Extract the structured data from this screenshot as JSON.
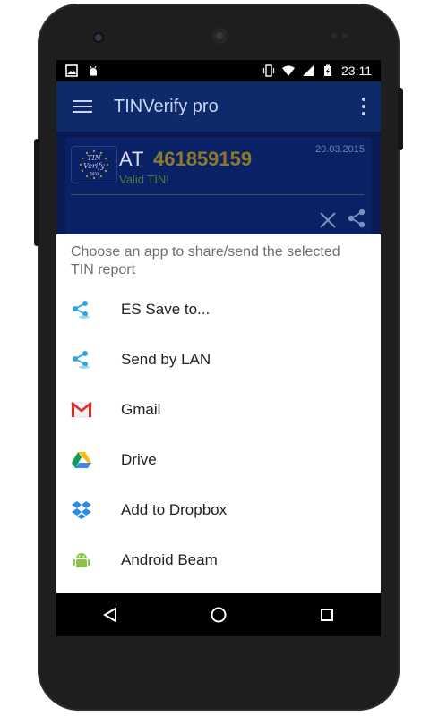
{
  "statusbar": {
    "time": "23:11",
    "icons": [
      "image-icon",
      "android-debug-icon",
      "vibrate-icon",
      "wifi-icon",
      "signal-icon",
      "battery-charging-icon"
    ]
  },
  "appbar": {
    "title": "TINVerify pro",
    "menu_icon": "hamburger-icon",
    "overflow_icon": "more-vert-icon"
  },
  "record": {
    "country": "AT",
    "tin": "461859159",
    "date": "20.03.2015",
    "status": "Valid TIN!",
    "logo_text": [
      "TIN",
      "Verify",
      "pro"
    ]
  },
  "sheet": {
    "title": "Choose an app to share/send the selected TIN report",
    "apps": [
      {
        "label": "ES Save to...",
        "icon": "es-share-icon"
      },
      {
        "label": "Send by LAN",
        "icon": "es-share-icon"
      },
      {
        "label": "Gmail",
        "icon": "gmail-icon"
      },
      {
        "label": "Drive",
        "icon": "drive-icon"
      },
      {
        "label": "Add to Dropbox",
        "icon": "dropbox-icon"
      },
      {
        "label": "Android Beam",
        "icon": "android-icon"
      }
    ]
  },
  "colors": {
    "appbar": "#0f2a6b",
    "accent_gold": "#8c7a2a",
    "valid_green": "#4d7b3d"
  }
}
